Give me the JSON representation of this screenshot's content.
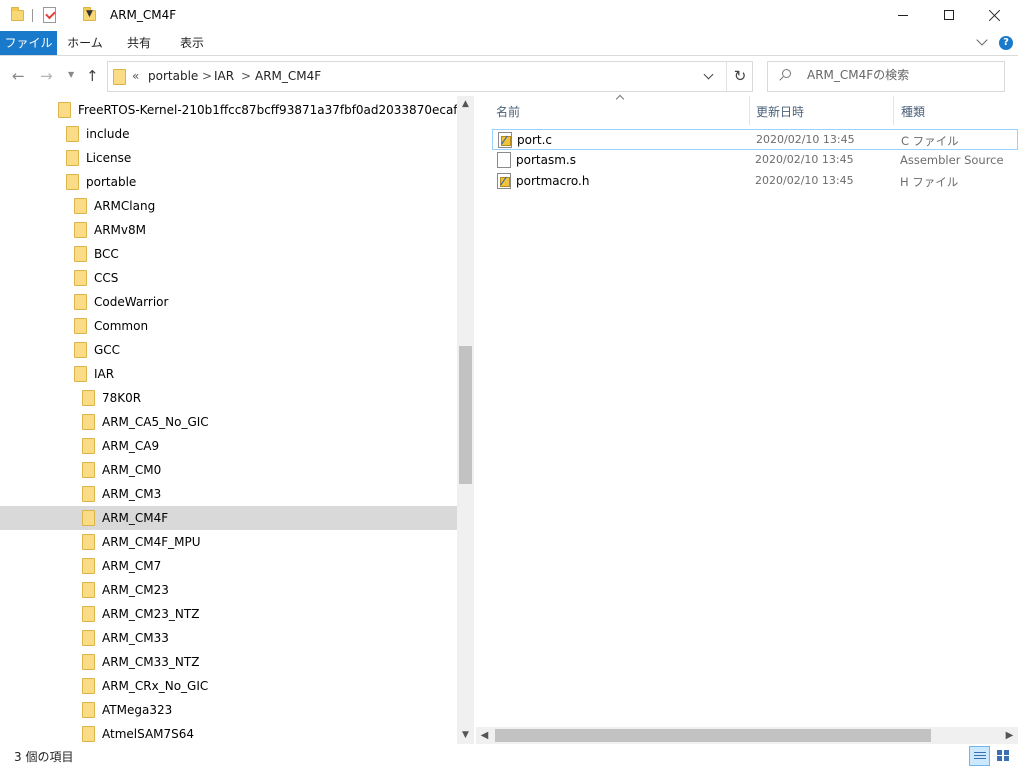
{
  "window": {
    "title": "ARM_CM4F"
  },
  "ribbon": {
    "tabs": [
      "ファイル",
      "ホーム",
      "共有",
      "表示"
    ],
    "help_label": "?"
  },
  "nav": {
    "overflow_label": "«",
    "breadcrumb": [
      "portable",
      "IAR",
      "ARM_CM4F"
    ],
    "separator": ">"
  },
  "search": {
    "placeholder": "ARM_CM4Fの検索"
  },
  "tree": {
    "items": [
      {
        "label": "FreeRTOS-Kernel-210b1ffcc87bcff93871a37fbf0ad2033870ecaf",
        "depth": 0
      },
      {
        "label": "include",
        "depth": 1
      },
      {
        "label": "License",
        "depth": 1
      },
      {
        "label": "portable",
        "depth": 1
      },
      {
        "label": "ARMClang",
        "depth": 2
      },
      {
        "label": "ARMv8M",
        "depth": 2
      },
      {
        "label": "BCC",
        "depth": 2
      },
      {
        "label": "CCS",
        "depth": 2
      },
      {
        "label": "CodeWarrior",
        "depth": 2
      },
      {
        "label": "Common",
        "depth": 2
      },
      {
        "label": "GCC",
        "depth": 2
      },
      {
        "label": "IAR",
        "depth": 2
      },
      {
        "label": "78K0R",
        "depth": 3
      },
      {
        "label": "ARM_CA5_No_GIC",
        "depth": 3
      },
      {
        "label": "ARM_CA9",
        "depth": 3
      },
      {
        "label": "ARM_CM0",
        "depth": 3
      },
      {
        "label": "ARM_CM3",
        "depth": 3
      },
      {
        "label": "ARM_CM4F",
        "depth": 3,
        "selected": true
      },
      {
        "label": "ARM_CM4F_MPU",
        "depth": 3
      },
      {
        "label": "ARM_CM7",
        "depth": 3
      },
      {
        "label": "ARM_CM23",
        "depth": 3
      },
      {
        "label": "ARM_CM23_NTZ",
        "depth": 3
      },
      {
        "label": "ARM_CM33",
        "depth": 3
      },
      {
        "label": "ARM_CM33_NTZ",
        "depth": 3
      },
      {
        "label": "ARM_CRx_No_GIC",
        "depth": 3
      },
      {
        "label": "ATMega323",
        "depth": 3
      },
      {
        "label": "AtmelSAM7S64",
        "depth": 3
      }
    ]
  },
  "list": {
    "columns": {
      "name": "名前",
      "date": "更新日時",
      "type": "種類"
    },
    "files": [
      {
        "name": "port.c",
        "date": "2020/02/10 13:45",
        "type": "C ファイル",
        "icon": "c-source-file-icon",
        "selected": true
      },
      {
        "name": "portasm.s",
        "date": "2020/02/10 13:45",
        "type": "Assembler Source",
        "icon": "blank-file-icon"
      },
      {
        "name": "portmacro.h",
        "date": "2020/02/10 13:45",
        "type": "H ファイル",
        "icon": "c-header-file-icon"
      }
    ]
  },
  "status": {
    "item_count": "3 個の項目"
  },
  "colors": {
    "accent": "#1979ca",
    "selection": "#d9d9d9",
    "folder": "#f8d775"
  }
}
